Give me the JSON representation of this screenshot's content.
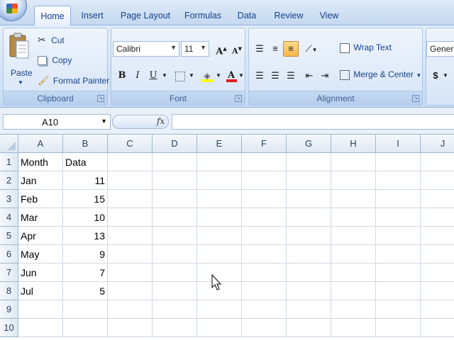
{
  "ribbon_tabs": [
    "Home",
    "Insert",
    "Page Layout",
    "Formulas",
    "Data",
    "Review",
    "View"
  ],
  "active_tab": "Home",
  "clipboard": {
    "paste": "Paste",
    "cut": "Cut",
    "copy": "Copy",
    "format_painter": "Format Painter",
    "label": "Clipboard"
  },
  "font": {
    "name": "Calibri",
    "size": "11",
    "label": "Font",
    "grow_glyph": "A",
    "shrink_glyph": "A",
    "bold": "B",
    "italic": "I",
    "underline": "U",
    "font_color_glyph": "A",
    "highlight_color": "#ffff00",
    "font_color": "#e01b1b"
  },
  "alignment": {
    "wrap_text": "Wrap Text",
    "merge_center": "Merge & Center",
    "label": "Alignment"
  },
  "number": {
    "format": "General",
    "currency": "$"
  },
  "formula_bar": {
    "name_box": "A10",
    "fx": "fx",
    "formula": ""
  },
  "columns": [
    "A",
    "B",
    "C",
    "D",
    "E",
    "F",
    "G",
    "H",
    "I",
    "J"
  ],
  "rows": [
    {
      "n": "1",
      "a": "Month",
      "b": "Data"
    },
    {
      "n": "2",
      "a": "Jan",
      "b": "11"
    },
    {
      "n": "3",
      "a": "Feb",
      "b": "15"
    },
    {
      "n": "4",
      "a": "Mar",
      "b": "10"
    },
    {
      "n": "5",
      "a": "Apr",
      "b": "13"
    },
    {
      "n": "6",
      "a": "May",
      "b": "9"
    },
    {
      "n": "7",
      "a": "Jun",
      "b": "7"
    },
    {
      "n": "8",
      "a": "Jul",
      "b": "5"
    },
    {
      "n": "9",
      "a": "",
      "b": ""
    },
    {
      "n": "10",
      "a": "",
      "b": ""
    }
  ]
}
